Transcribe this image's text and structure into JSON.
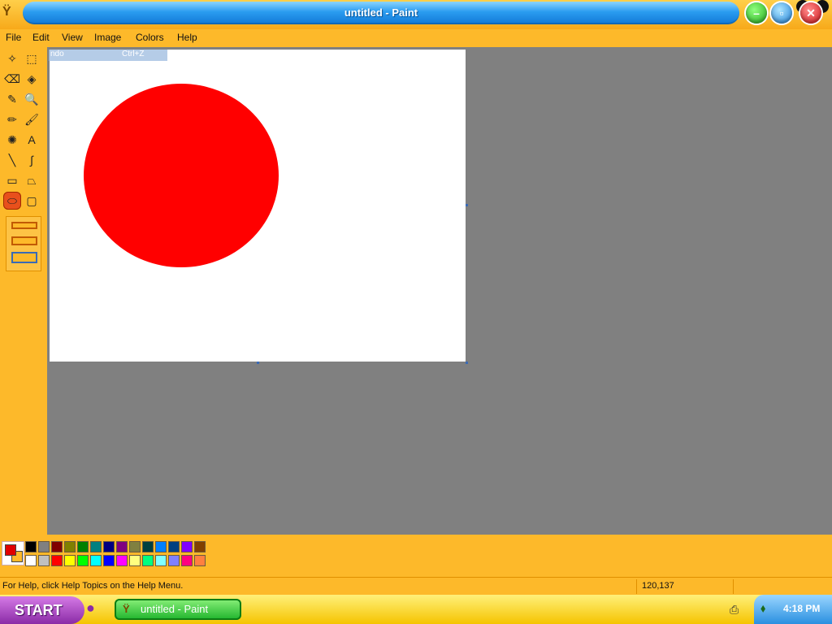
{
  "window": {
    "title": "untitled - Paint"
  },
  "menu": [
    "File",
    "Edit",
    "View",
    "Image",
    "Colors",
    "Help"
  ],
  "tools": [
    {
      "name": "free-select-icon",
      "glyph": "✧"
    },
    {
      "name": "rect-select-icon",
      "glyph": "⬚"
    },
    {
      "name": "eraser-icon",
      "glyph": "⌫"
    },
    {
      "name": "fill-icon",
      "glyph": "◈"
    },
    {
      "name": "color-picker-icon",
      "glyph": "✎"
    },
    {
      "name": "magnifier-icon",
      "glyph": "🔍"
    },
    {
      "name": "pencil-icon",
      "glyph": "✏"
    },
    {
      "name": "brush-icon",
      "glyph": "🖌"
    },
    {
      "name": "airbrush-icon",
      "glyph": "✺"
    },
    {
      "name": "text-icon",
      "glyph": "A"
    },
    {
      "name": "line-icon",
      "glyph": "╲"
    },
    {
      "name": "curve-icon",
      "glyph": "∫"
    },
    {
      "name": "rectangle-icon",
      "glyph": "▭"
    },
    {
      "name": "polygon-icon",
      "glyph": "⏢"
    },
    {
      "name": "ellipse-icon",
      "glyph": "⬭",
      "selected": true
    },
    {
      "name": "rounded-rect-icon",
      "glyph": "▢"
    }
  ],
  "undo_hint": {
    "label": "ndo",
    "shortcut": "Ctrl+Z"
  },
  "palette": {
    "foreground": "#e00000",
    "background": "#fdb92a",
    "row1": [
      "#000000",
      "#808080",
      "#800000",
      "#808000",
      "#008000",
      "#008080",
      "#000080",
      "#800080",
      "#808040",
      "#004040",
      "#0080ff",
      "#004080",
      "#8000ff",
      "#804000"
    ],
    "row2": [
      "#ffffff",
      "#c0c0c0",
      "#ff0000",
      "#ffff00",
      "#00ff00",
      "#00ffff",
      "#0000ff",
      "#ff00ff",
      "#ffff80",
      "#00ff80",
      "#80ffff",
      "#8080ff",
      "#ff0080",
      "#ff8040"
    ]
  },
  "status": {
    "help_text": "For Help, click Help Topics on the Help Menu.",
    "coords": "120,137"
  },
  "taskbar": {
    "start_label": "START",
    "task_label": "untitled - Paint",
    "clock": "4:18 PM"
  }
}
